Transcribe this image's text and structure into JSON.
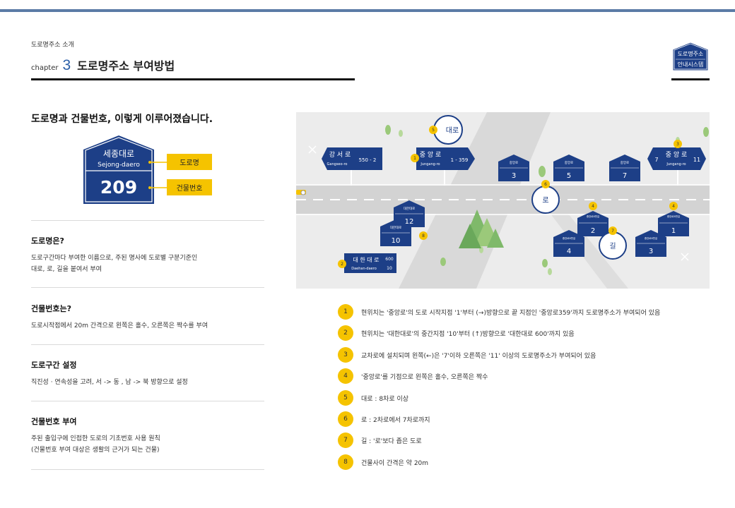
{
  "header": {
    "breadcrumb": "도로명주소 소개",
    "chapter_word": "chapter",
    "chapter_number": "3",
    "chapter_title": "도로명주소 부여방법"
  },
  "logo": {
    "line1": "도로명주소",
    "line2": "안내시스템"
  },
  "section_title": "도로명과 건물번호, 이렇게 이루어졌습니다.",
  "sign": {
    "road_name": "세종대로",
    "road_name_en": "Sejong-daero",
    "number": "209",
    "label_road": "도로명",
    "label_number": "건물번호"
  },
  "items": [
    {
      "title": "도로명은?",
      "desc": "도로구간마다 부여한 이름으로, 주된 명사에 도로별 구분기준인\n대로, 로, 길을 붙여서 부여"
    },
    {
      "title": "건물번호는?",
      "desc": "도로시작점에서 20m 간격으로 왼쪽은 홀수, 오른쪽은 짝수를 부여"
    },
    {
      "title": "도로구간 설정",
      "desc": "직진성 · 연속성을 고려, 서 -> 동 , 남 -> 북 방향으로 설정"
    },
    {
      "title": "건물번호 부여",
      "desc": "주된 출입구에 인접한 도로의 기초번호 사용 원칙\n(건물번호 부여 대상은 생활의 근거가 되는 건물)"
    }
  ],
  "map": {
    "sign_gangseo": {
      "name": "강 서 로",
      "en": "Gangseo-ro",
      "range": "550 - 2"
    },
    "sign_jungang": {
      "name": "중 앙 로",
      "en": "Jungang-ro",
      "range": "1 - 359"
    },
    "sign_jungang_cross": {
      "name": "중 앙 로",
      "en": "Jungang-ro",
      "left": "7",
      "right": "11"
    },
    "sign_daehan": {
      "name": "대 한 대 로",
      "en": "Daehan-daero",
      "top": "600",
      "bottom": "10"
    },
    "circle_daero": "대로",
    "circle_ro": "로",
    "circle_gil": "길",
    "house_label": "중앙로",
    "house_label_gil": "중앙로8번길",
    "daehan_house_label": "대한대로",
    "houses_top": [
      "3",
      "5",
      "7"
    ],
    "houses_daehan": [
      "12",
      "10"
    ],
    "houses_gil": [
      "2",
      "1",
      "4",
      "3"
    ],
    "markers": [
      "1",
      "2",
      "3",
      "4",
      "4",
      "5",
      "6",
      "7",
      "8"
    ]
  },
  "legend": [
    {
      "num": "1",
      "text": "현위치는 '중앙로'의 도로 시작지점 '1'부터 (→)방향으로 끝 지점인 '중앙로359'까지 도로명주소가 부여되어 있음"
    },
    {
      "num": "2",
      "text": "현위치는 '대한대로'의 중간지점 '10'부터 (↑)방향으로 '대한대로 600'까지 있음"
    },
    {
      "num": "3",
      "text": "교차로에 설치되며 왼쪽(←)은 '7'이하 오른쪽은 '11' 이상의 도로명주소가 부여되어 있음"
    },
    {
      "num": "4",
      "text": "'중앙로'를 기점으로 왼쪽은 홀수, 오른쪽은 짝수"
    },
    {
      "num": "5",
      "text": "대로 : 8차로 이상"
    },
    {
      "num": "6",
      "text": "로 : 2차로에서 7차로까지"
    },
    {
      "num": "7",
      "text": "길 : '로'보다 좁은 도로"
    },
    {
      "num": "8",
      "text": "건물사이 간격은 약 20m"
    }
  ],
  "colors": {
    "navy": "#1d3f87",
    "yellow": "#f5c300",
    "topbar": "#5b7ba6"
  }
}
